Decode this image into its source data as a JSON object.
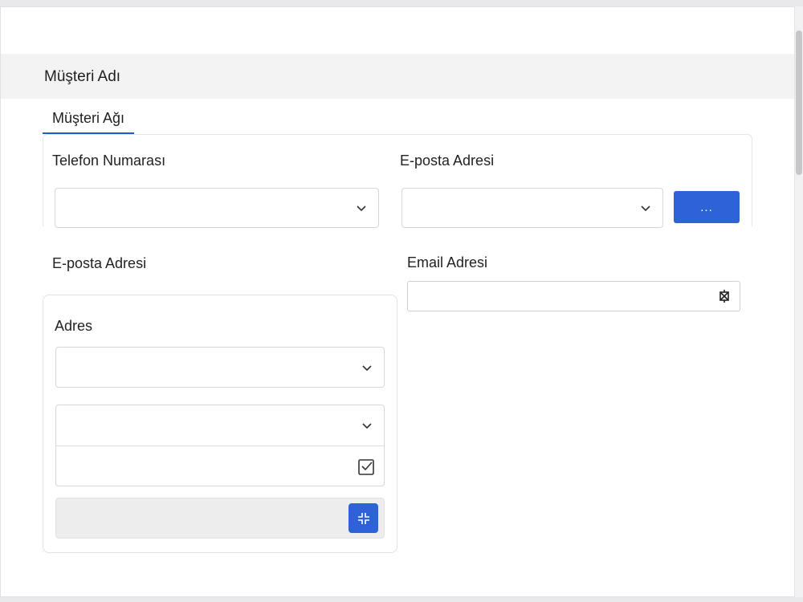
{
  "header": {
    "title": "Müşteri Adı"
  },
  "tabs": [
    {
      "label": "Müşteri Ağı",
      "active": true
    }
  ],
  "contact_panel": {
    "phone": {
      "label": "Telefon Numarası",
      "value": ""
    },
    "email": {
      "label": "E-posta Adresi",
      "value": ""
    },
    "more_button": "..."
  },
  "email_section": {
    "label": "E-posta Adresi"
  },
  "email_field": {
    "label": "Email Adresi",
    "value": "",
    "icon": "email-icon"
  },
  "address_panel": {
    "label": "Adres",
    "select1": {
      "value": ""
    },
    "select2": {
      "value": ""
    },
    "check_field": {
      "value": "",
      "icon": "checkbox-icon"
    },
    "action_icon": "expand-icon"
  },
  "colors": {
    "accent": "#2e63d8",
    "tab_underline": "#1f5bd1",
    "header_band": "#f3f3f4"
  }
}
